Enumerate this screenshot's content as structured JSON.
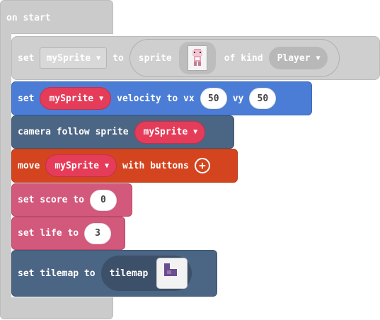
{
  "event": {
    "label": "on start"
  },
  "blocks": {
    "set_sprite": {
      "set": "set",
      "variable": "mySprite",
      "to": "to",
      "sprite": "sprite",
      "of_kind": "of kind",
      "kind": "Player"
    },
    "velocity": {
      "set": "set",
      "variable": "mySprite",
      "velocity_to_vx": "velocity to vx",
      "vx": "50",
      "vy_label": "vy",
      "vy": "50"
    },
    "camera": {
      "label": "camera follow sprite",
      "variable": "mySprite"
    },
    "move": {
      "move": "move",
      "variable": "mySprite",
      "with_buttons": "with buttons"
    },
    "score": {
      "label": "set score to",
      "value": "0"
    },
    "life": {
      "label": "set life to",
      "value": "3"
    },
    "tilemap": {
      "label": "set tilemap to",
      "tilemap": "tilemap"
    }
  },
  "colors": {
    "event": "#cbcbcb",
    "sprites": "#4c7dd6",
    "scene": "#4b6584",
    "controller": "#d4451f",
    "info": "#d2587c",
    "variable": "#e43c59"
  },
  "icons": {
    "dropdown": "▼",
    "add": "+"
  }
}
